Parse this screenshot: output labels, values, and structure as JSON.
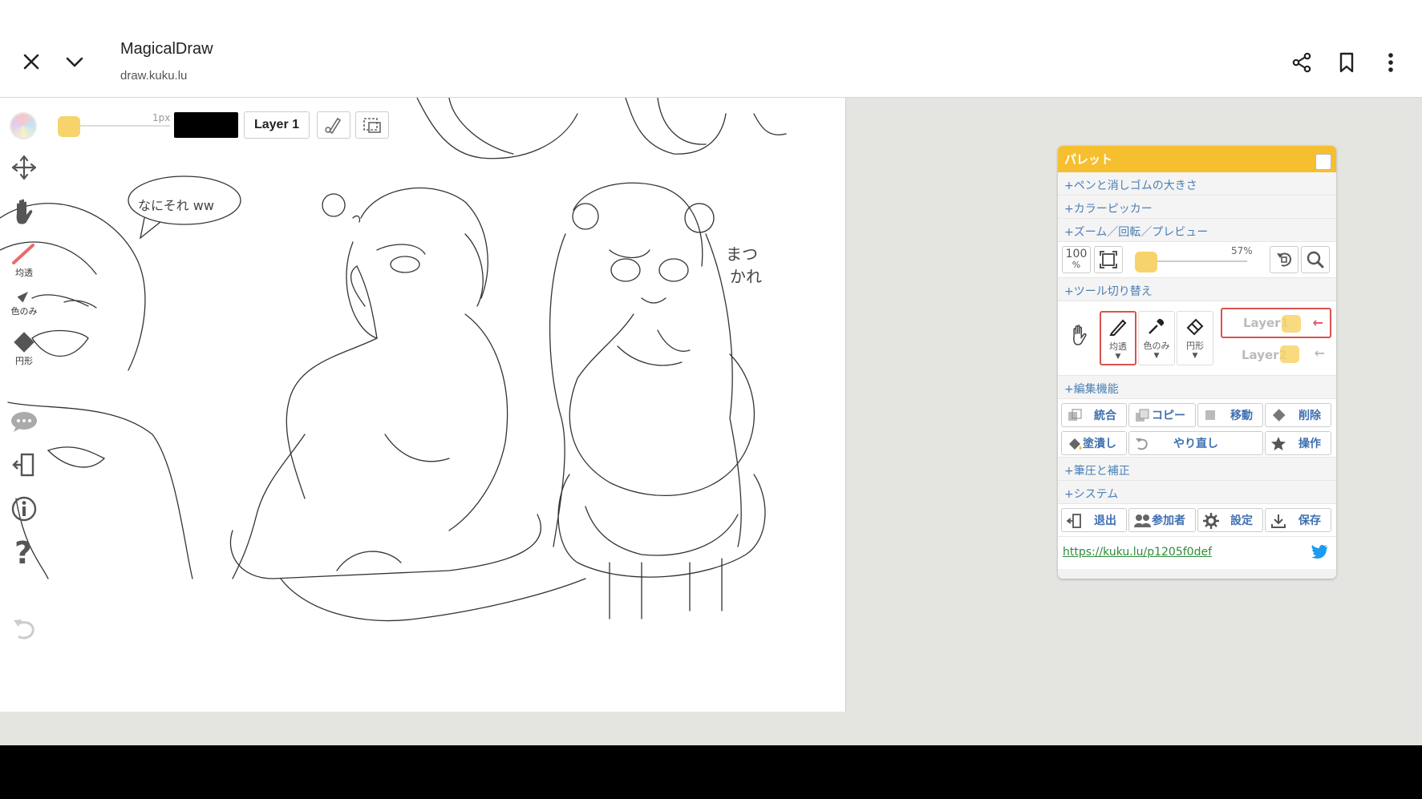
{
  "browser": {
    "title": "MagicalDraw",
    "url": "draw.kuku.lu",
    "icons": [
      "close-icon",
      "chevron-down-icon",
      "share-icon",
      "bookmark-icon",
      "more-vert-icon"
    ]
  },
  "canvas_toolbar": {
    "brush_size": "1px",
    "layer_button": "Layer 1",
    "accent_color": "#f7d36b"
  },
  "side_tools": {
    "pen_label": "均透",
    "color_label": "色のみ",
    "eraser_label": "円形"
  },
  "sketch_text": {
    "bubble": "なにそれ ww",
    "note_line1": "まつ",
    "note_line2": "かれ"
  },
  "palette": {
    "title": "パレット",
    "sections": {
      "pen_size": "+ペンと消しゴムの大きさ",
      "color_picker": "+カラーピッカー",
      "zoom": "+ズーム／回転／プレビュー",
      "tool_switch": "+ツール切り替え",
      "edit": "+編集機能",
      "pressure": "+筆圧と補正",
      "system": "+システム"
    },
    "zoom": {
      "reset_label": "100",
      "reset_unit": "%",
      "percent": "57%"
    },
    "tools": {
      "pen": "均透",
      "color": "色のみ",
      "eraser": "円形"
    },
    "layers": [
      "Layer1",
      "Layer2"
    ],
    "edit_buttons": {
      "merge": "統合",
      "copy": "コピー",
      "move": "移動",
      "delete": "削除",
      "fill": "塗潰し",
      "redo": "やり直し",
      "operation": "操作"
    },
    "system_buttons": {
      "exit": "退出",
      "participants": "参加者",
      "settings": "設定",
      "save": "保存"
    },
    "share_url": "https://kuku.lu/p1205f0def"
  }
}
